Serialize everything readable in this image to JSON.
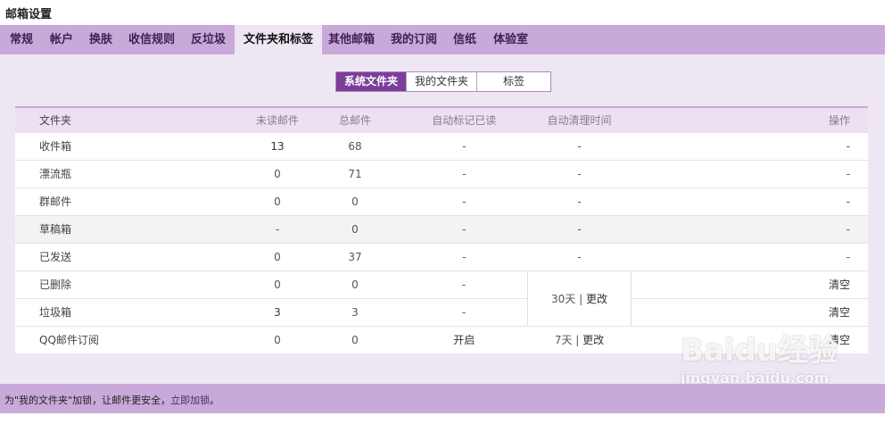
{
  "title": "邮箱设置",
  "tabs": [
    {
      "label": "常规"
    },
    {
      "label": "帐户"
    },
    {
      "label": "换肤"
    },
    {
      "label": "收信规则"
    },
    {
      "label": "反垃圾"
    },
    {
      "label": "文件夹和标签"
    },
    {
      "label": "其他邮箱"
    },
    {
      "label": "我的订阅"
    },
    {
      "label": "信纸"
    },
    {
      "label": "体验室"
    }
  ],
  "segment": [
    {
      "label": "系统文件夹"
    },
    {
      "label": "我的文件夹"
    },
    {
      "label": "标签"
    }
  ],
  "table": {
    "headers": [
      "文件夹",
      "未读邮件",
      "总邮件",
      "自动标记已读",
      "自动清理时间",
      "操作"
    ],
    "rows": [
      [
        "收件箱",
        "13",
        "68",
        "-",
        "-",
        "-"
      ],
      [
        "漂流瓶",
        "0",
        "71",
        "-",
        "-",
        "-"
      ],
      [
        "群邮件",
        "0",
        "0",
        "-",
        "-",
        "-"
      ],
      [
        "草稿箱",
        "-",
        "0",
        "-",
        "-",
        "-"
      ],
      [
        "已发送",
        "0",
        "37",
        "-",
        "-",
        "-"
      ],
      [
        "已删除",
        "0",
        "0",
        "-",
        "",
        "清空"
      ],
      [
        "垃圾箱",
        "3",
        "3",
        "-",
        "",
        "清空"
      ],
      [
        "QQ邮件订阅",
        "0",
        "0",
        "开启",
        "",
        "清空"
      ]
    ],
    "merged_cleanup": {
      "days": "30天",
      "sep": "|",
      "edit": "更改"
    },
    "sub_cleanup": {
      "days": "7天",
      "sep": "|",
      "edit": "更改"
    }
  },
  "footer": {
    "text": "为\"我的文件夹\"加锁，让邮件更安全，",
    "link": "立即加锁",
    "tail": "。"
  },
  "watermark": {
    "line1": "Baidu经验",
    "line2": "jingyan.baidu.com"
  }
}
